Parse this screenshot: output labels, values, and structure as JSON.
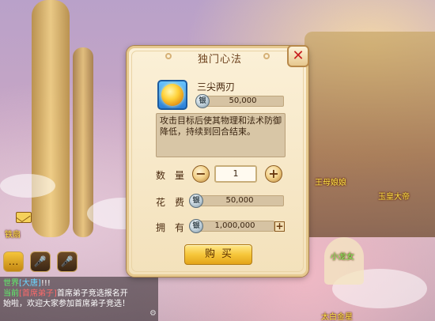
{
  "dialog": {
    "title": "独门心法",
    "skill": {
      "name": "三尖两刃",
      "price": "50,000",
      "description": "攻击目标后使其物理和法术防御降低，持续到回合结束。"
    },
    "quantity": {
      "label": "数　量",
      "value": "1",
      "minus": "−",
      "plus": "+"
    },
    "cost": {
      "label": "花　费",
      "value": "50,000"
    },
    "owned": {
      "label": "拥　有",
      "value": "1,000,000",
      "plus": "+"
    },
    "buy_label": "购买",
    "close_icon": "✕"
  },
  "coin_glyph": "银",
  "npc_labels": {
    "left": "铁扇",
    "right_top": "王母娘娘",
    "right_mid": "玉皇大帝",
    "right_low": "小龙女",
    "right_bottom": "太白金星"
  },
  "chat": {
    "lines": [
      {
        "channel": "世界",
        "name": "[大唐]",
        "text": "!!!"
      },
      {
        "prefix": "当前",
        "highlight": "[首席弟子]",
        "text": "首席弟子竞选报名开"
      },
      {
        "text": "始啦，欢迎大家参加首席弟子竞选！"
      }
    ],
    "scroll_glyph": "⚙"
  },
  "icons": {
    "mail": "mail-icon",
    "chat_bubble": "chat-bubble-icon",
    "mic1": "microphone-icon",
    "mic2": "microphone-icon"
  },
  "colors": {
    "accent_gold": "#f6c63a",
    "close_red": "#c81e1e",
    "npc_yellow": "#ffe84a"
  }
}
